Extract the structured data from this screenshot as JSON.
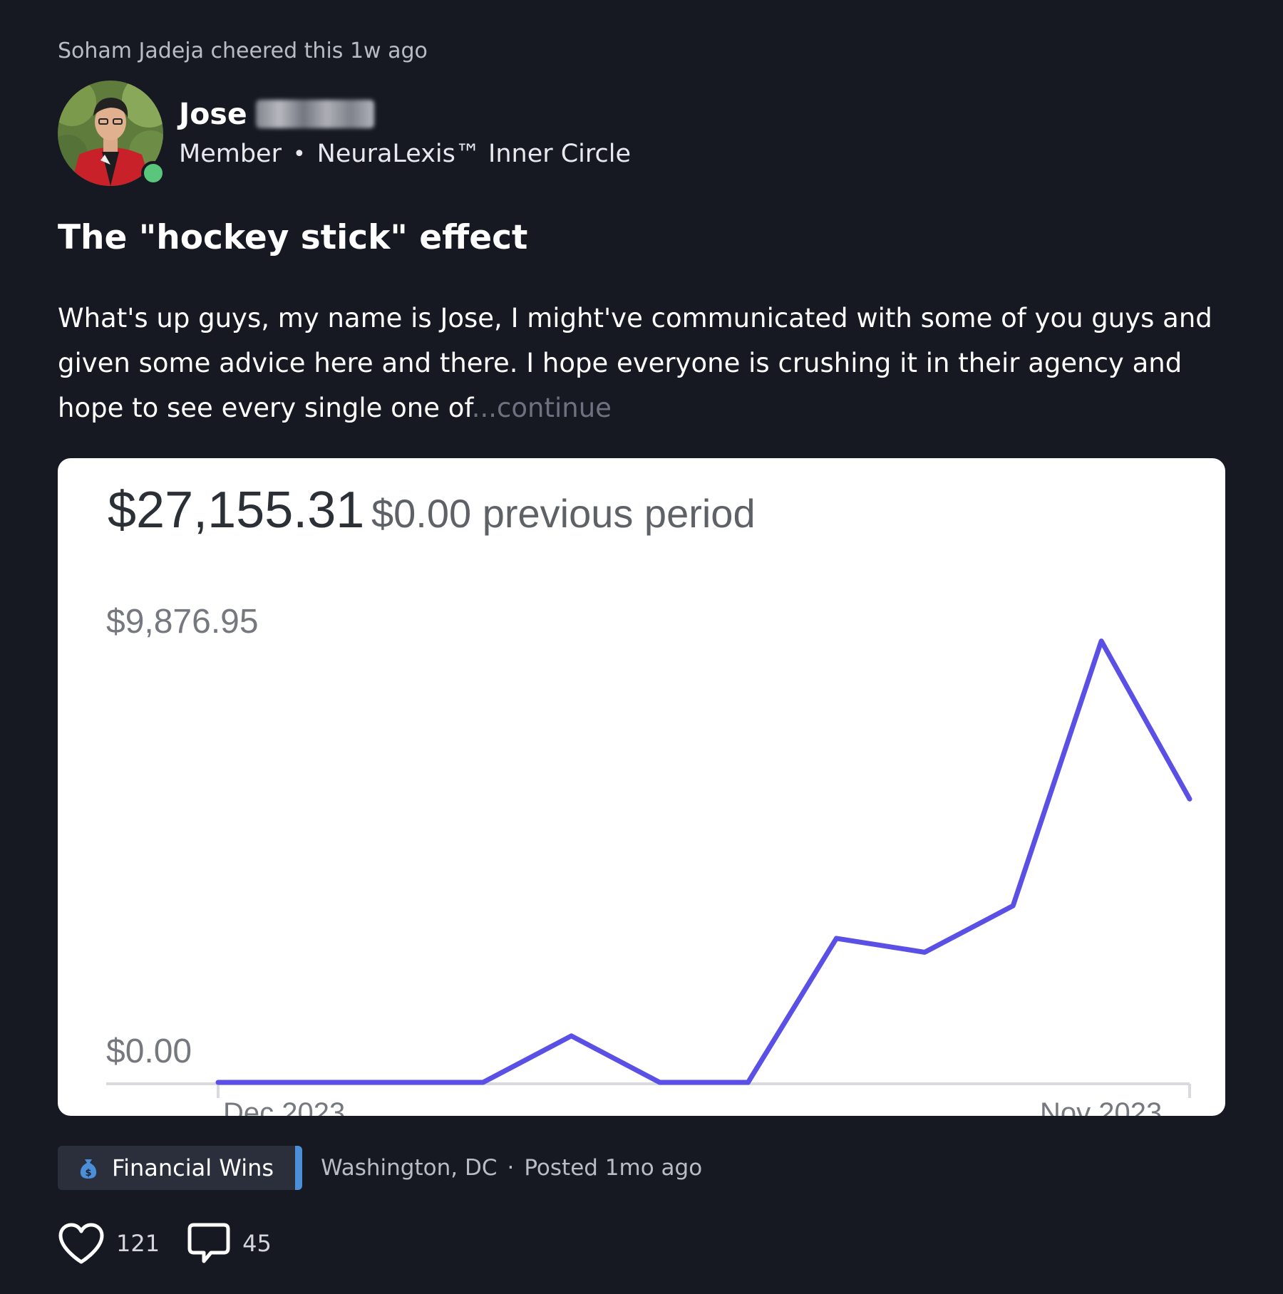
{
  "activity": {
    "cheer_text": "Soham Jadeja cheered this 1w ago"
  },
  "author": {
    "first_name": "Jose",
    "role": "Member",
    "group": "NeuraLexis™ Inner Circle",
    "online": true
  },
  "post": {
    "title": "The \"hockey stick\" effect",
    "body": "What's up guys, my name is Jose, I might've communicated with some of you guys and given some advice here and there. I hope everyone is crushing it in their agency and hope to see every single one of",
    "continue_label": "...continue"
  },
  "chart_data": {
    "type": "line",
    "total": "$27,155.31",
    "comparison": "$0.00 previous period",
    "y_tick_labels": [
      "$9,876.95",
      "$0.00"
    ],
    "ylim": [
      0,
      9876.95
    ],
    "x": [
      0,
      1,
      2,
      3,
      4,
      5,
      6,
      7,
      8,
      9,
      10,
      11
    ],
    "series": [
      {
        "color": "#5b50e6",
        "values": [
          0,
          0,
          0,
          0,
          1000,
          0,
          0,
          3100,
          2800,
          3800,
          9500,
          6100
        ]
      }
    ],
    "grid": false
  },
  "footer": {
    "category": "Financial Wins",
    "category_icon": "money-bag-icon",
    "location": "Washington, DC",
    "separator": "·",
    "posted": "Posted 1mo ago"
  },
  "actions": {
    "likes": "121",
    "comments": "45"
  },
  "colors": {
    "background": "#161922",
    "accent_tag": "#4a8fd8",
    "chart_line": "#5b50e6",
    "online": "#5ac67c"
  }
}
